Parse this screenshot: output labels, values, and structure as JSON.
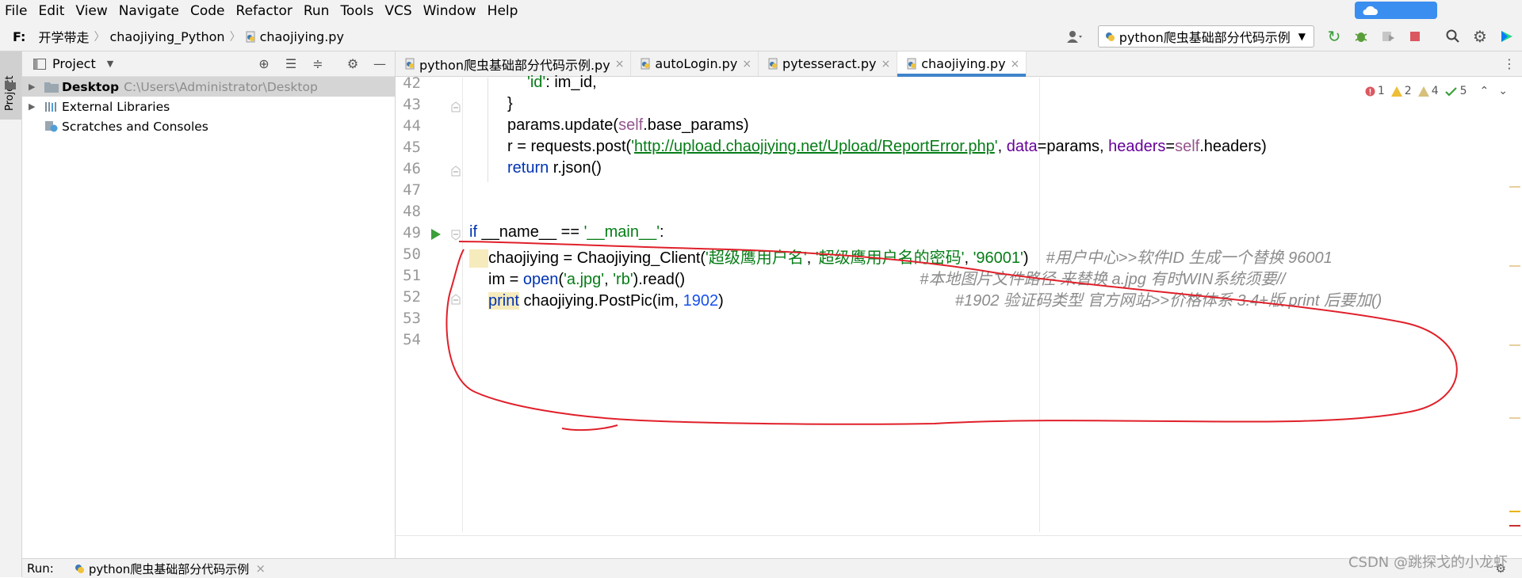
{
  "menu": [
    "File",
    "Edit",
    "View",
    "Navigate",
    "Code",
    "Refactor",
    "Run",
    "Tools",
    "VCS",
    "Window",
    "Help"
  ],
  "cloud_badge": "",
  "breadcrumb": {
    "drive": "F:",
    "items": [
      "开学带走",
      "chaojiying_Python",
      "chaojiying.py"
    ]
  },
  "run_config": "python爬虫基础部分代码示例",
  "project_panel": {
    "title": "Project",
    "tree": [
      {
        "label": "Desktop",
        "path": "C:\\Users\\Administrator\\Desktop",
        "selected": true
      },
      {
        "label": "External Libraries"
      },
      {
        "label": "Scratches and Consoles"
      }
    ]
  },
  "side_tab": "Project",
  "tabs": [
    {
      "label": "python爬虫基础部分代码示例.py",
      "active": false
    },
    {
      "label": "autoLogin.py",
      "active": false
    },
    {
      "label": "pytesseract.py",
      "active": false
    },
    {
      "label": "chaojiying.py",
      "active": true
    }
  ],
  "inspections": {
    "errors": "1",
    "warnings": "2",
    "weak": "4",
    "ok": "5"
  },
  "code": {
    "line_numbers": [
      "42",
      "43",
      "44",
      "45",
      "46",
      "47",
      "48",
      "49",
      "50",
      "51",
      "52",
      "53",
      "54"
    ],
    "l42_str": "'id'",
    "l42_rest": ": im_id,",
    "l43": "}",
    "l44_a": "params.update(",
    "l44_self": "self",
    "l44_b": ".base_params)",
    "l45_a": "r = requests.post(",
    "l45_q1": "'",
    "l45_url": "http://upload.chaojiying.net/Upload/ReportError.php",
    "l45_q2": "'",
    "l45_b": ", ",
    "l45_data": "data",
    "l45_c": "=params, ",
    "l45_headers": "headers",
    "l45_d": "=",
    "l45_self": "self",
    "l45_e": ".headers)",
    "l46_kw": "return",
    "l46_rest": " r.json()",
    "l49_kw": "if",
    "l49_a": " __name__ == ",
    "l49_str": "'__main__'",
    "l49_b": ":",
    "l50_a": "chaojiying = Chaojiying_Client(",
    "l50_s1": "'超级鹰用户名'",
    "l50_c1": ", ",
    "l50_s2": "'超级鹰用户名的密码'",
    "l50_c2": ", ",
    "l50_s3": "'96001'",
    "l50_b": ")",
    "l50_cmt": "#用户中心>>软件ID 生成一个替换 96001",
    "l51_a": "im = ",
    "l51_open": "open",
    "l51_b": "(",
    "l51_s1": "'a.jpg'",
    "l51_c": ", ",
    "l51_s2": "'rb'",
    "l51_d": ").read()",
    "l51_cmt": "#本地图片文件路径 来替换 a.jpg 有时WIN系统须要//",
    "l52_print": "print",
    "l52_a": " chaojiying.PostPic(im, ",
    "l52_num": "1902",
    "l52_b": ")",
    "l52_cmt": "#1902 验证码类型  官方网站>>价格体系 3.4+版 print 后要加()"
  },
  "bottom": {
    "run_label": "Run:",
    "run_tab": "python爬虫基础部分代码示例"
  },
  "watermark": "CSDN @跳探戈的小龙虾",
  "colors": {
    "keyword": "#0033b3",
    "string": "#067d17",
    "self": "#94558d",
    "number": "#1750eb",
    "comment": "#8c8c8c",
    "annotation": "#e0202a",
    "active_tab": "#4083c9"
  }
}
